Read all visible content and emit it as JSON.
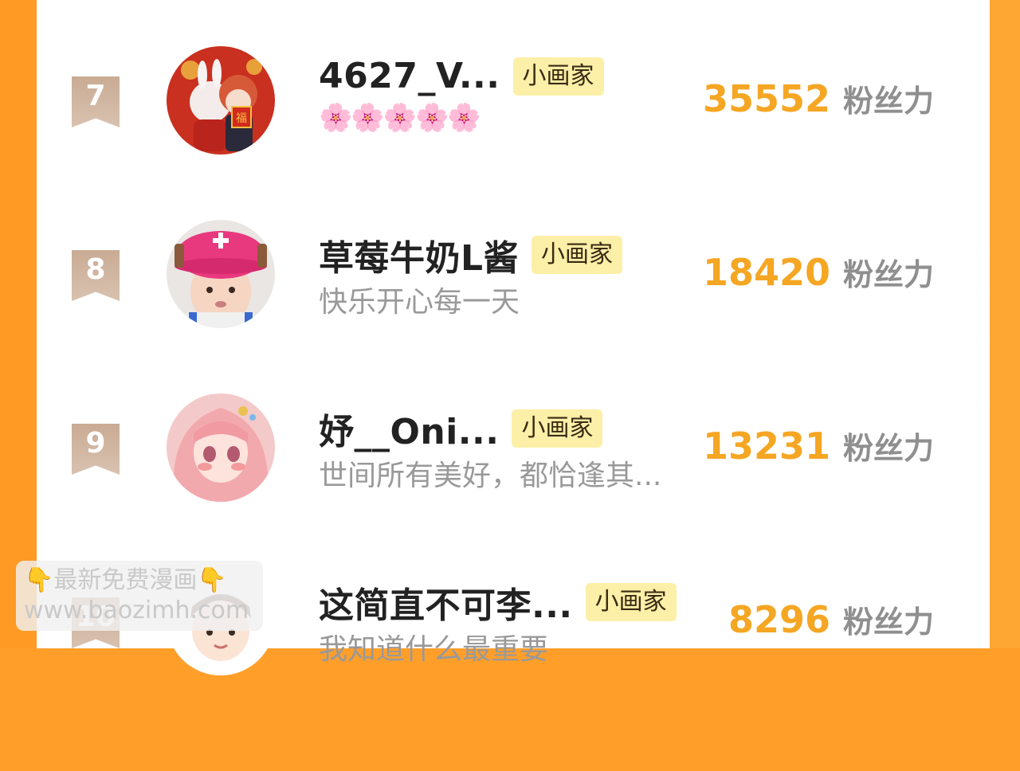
{
  "rows": [
    {
      "rank": "7",
      "name": "4627_V...",
      "tag": "小画家",
      "subtitle": "🌸🌸🌸🌸🌸",
      "fans": "35552",
      "fans_label": "粉丝力",
      "avatar_icon": "anime-couple-avatar"
    },
    {
      "rank": "8",
      "name": "草莓牛奶L酱",
      "tag": "小画家",
      "subtitle": "快乐开心每一天",
      "fans": "18420",
      "fans_label": "粉丝力",
      "avatar_icon": "child-pink-hat-avatar"
    },
    {
      "rank": "9",
      "name": "妤__Oni...",
      "tag": "小画家",
      "subtitle": "世间所有美好，都恰逢其...",
      "fans": "13231",
      "fans_label": "粉丝力",
      "avatar_icon": "anime-girl-pink-avatar"
    },
    {
      "rank": "10",
      "name": "这简直不可李...",
      "tag": "小画家",
      "subtitle": "我知道什么最重要",
      "fans": "8296",
      "fans_label": "粉丝力",
      "avatar_icon": "cartoon-boy-avatar"
    }
  ],
  "watermark": {
    "line1_left_icon": "👇",
    "line1_text": "最新免费漫画",
    "line1_right_icon": "👇",
    "line2_text": "www.baozimh.com"
  },
  "colors": {
    "frame": "#ff9f2a",
    "fans_number": "#f5a623",
    "tag_bg": "#fcefa8",
    "rank_badge": "#cbb09a"
  }
}
